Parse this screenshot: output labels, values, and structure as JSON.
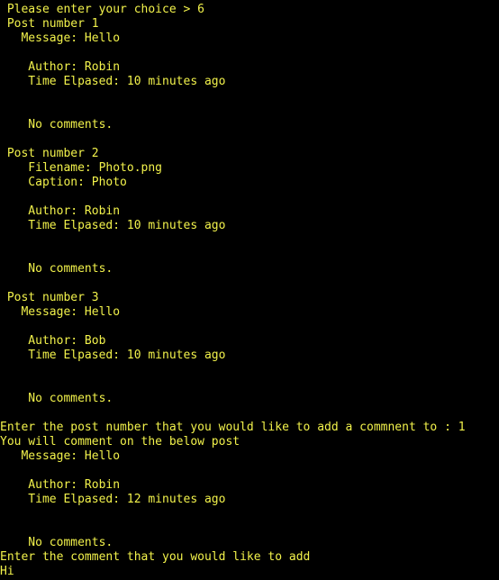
{
  "terminal": {
    "colors": {
      "background": "#000000",
      "text": "#f2f24b"
    },
    "lines": [
      " Please enter your choice > 6",
      " Post number 1",
      "   Message: Hello",
      "",
      "    Author: Robin",
      "    Time Elpased: 10 minutes ago",
      "",
      "",
      "    No comments.",
      "",
      " Post number 2",
      "    Filename: Photo.png",
      "    Caption: Photo",
      "",
      "    Author: Robin",
      "    Time Elpased: 10 minutes ago",
      "",
      "",
      "    No comments.",
      "",
      " Post number 3",
      "   Message: Hello",
      "",
      "    Author: Bob",
      "    Time Elpased: 10 minutes ago",
      "",
      "",
      "    No comments.",
      "",
      "Enter the post number that you would like to add a commnent to : 1",
      "You will comment on the below post",
      "   Message: Hello",
      "",
      "    Author: Robin",
      "    Time Elpased: 12 minutes ago",
      "",
      "",
      "    No comments.",
      "Enter the comment that you would like to add",
      "Hi"
    ]
  }
}
